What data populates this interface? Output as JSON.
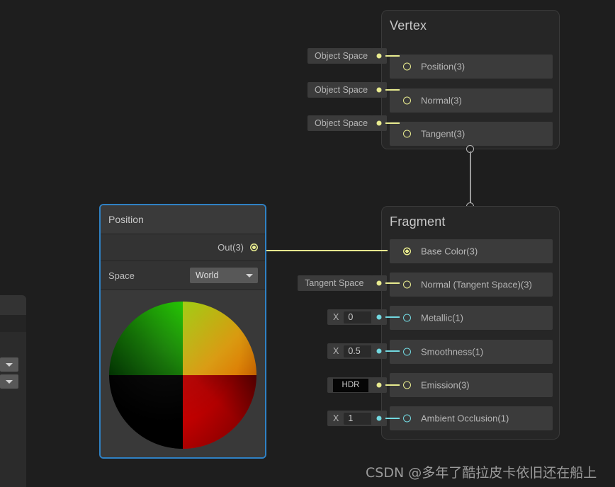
{
  "canvas": {
    "background_color": "#1e1e1e",
    "watermark": "CSDN @多年了酷拉皮卡依旧还在船上"
  },
  "left_panel": {
    "dropdown_one_icon": "chevron-down-icon",
    "dropdown_two_icon": "chevron-down-icon"
  },
  "vertex_node": {
    "title": "Vertex",
    "slots": [
      {
        "label": "Position(3)",
        "space_chip": "Object Space",
        "port_color": "#e8eb8f",
        "connected": false
      },
      {
        "label": "Normal(3)",
        "space_chip": "Object Space",
        "port_color": "#e8eb8f",
        "connected": false
      },
      {
        "label": "Tangent(3)",
        "space_chip": "Object Space",
        "port_color": "#e8eb8f",
        "connected": false
      }
    ]
  },
  "fragment_node": {
    "title": "Fragment",
    "slots": [
      {
        "label": "Base Color(3)",
        "control": "none",
        "port_color": "#e8eb8f",
        "connected": true
      },
      {
        "label": "Normal (Tangent Space)(3)",
        "control": "space",
        "space_chip": "Tangent Space",
        "port_color": "#e8eb8f",
        "connected": false
      },
      {
        "label": "Metallic(1)",
        "control": "value",
        "axis": "X",
        "value": "0",
        "port_color": "#72d8e0",
        "connected": false
      },
      {
        "label": "Smoothness(1)",
        "control": "value",
        "axis": "X",
        "value": "0.5",
        "port_color": "#72d8e0",
        "connected": false
      },
      {
        "label": "Emission(3)",
        "control": "hdr",
        "hdr_label": "HDR",
        "swatch_color": "#050505",
        "port_color": "#e8eb8f",
        "connected": false
      },
      {
        "label": "Ambient Occlusion(1)",
        "control": "value",
        "axis": "X",
        "value": "1",
        "port_color": "#72d8e0",
        "connected": false
      }
    ]
  },
  "position_node": {
    "title": "Position",
    "selected": true,
    "selection_color": "#2f81c4",
    "output_port_label": "Out(3)",
    "space_property_label": "Space",
    "space_value": "World",
    "space_dropdown_icon": "chevron-down-icon",
    "preview": {
      "shape": "sphere",
      "quadrant_top_left": "#22c400",
      "quadrant_top_right": "#d99a10",
      "quadrant_bottom_left": "#000000",
      "quadrant_bottom_right": "#cc0000"
    }
  },
  "connections": {
    "vertex_to_fragment": {
      "color": "#9b9b9b"
    },
    "position_out_to_base_color": {
      "color": "#e8eb8f"
    }
  }
}
